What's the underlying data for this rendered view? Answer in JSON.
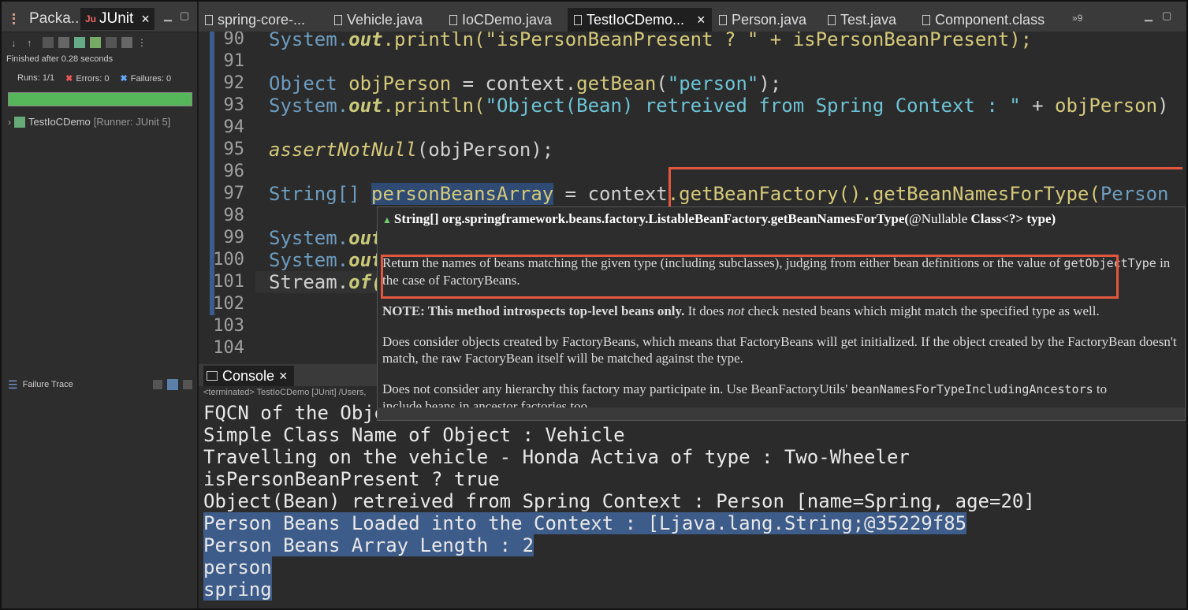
{
  "left_panel": {
    "tabs": [
      {
        "label": "Packa..."
      },
      {
        "label": "JUnit",
        "close": "×"
      }
    ],
    "status": "Finished after 0.28 seconds",
    "runs_label": "Runs:",
    "runs_value": "1/1",
    "errors_label": "Errors:",
    "errors_value": "0",
    "failures_label": "Failures:",
    "failures_value": "0",
    "progress_fraction": 1.0,
    "progress_color": "#56b75a",
    "test_name": "TestIoCDemo",
    "test_runner": "[Runner: JUnit 5]",
    "failure_trace_label": "Failure Trace"
  },
  "editor_tabs": [
    {
      "label": "spring-core-..."
    },
    {
      "label": "Vehicle.java"
    },
    {
      "label": "IoCDemo.java"
    },
    {
      "label": "TestIoCDemo...",
      "active": true,
      "close": "×"
    },
    {
      "label": "Person.java"
    },
    {
      "label": "Test.java"
    },
    {
      "label": "Component.class"
    },
    {
      "label": "»9"
    }
  ],
  "editor": {
    "line_numbers": [
      "90",
      "91",
      "92",
      "93",
      "94",
      "95",
      "96",
      "97",
      "98",
      "99",
      "100",
      "101",
      "102",
      "103",
      "104"
    ],
    "code": {
      "l90_a": "System.",
      "l90_b": "out",
      "l90_c": ".println(\"isPersonBeanPresent ? \" + isPersonBeanPresent);",
      "l92_a": "Object ",
      "l92_b": "objPerson",
      "l92_c": " = context.",
      "l92_d": "getBean",
      "l92_e": "(",
      "l92_f": "\"person\"",
      "l92_g": ");",
      "l93_a": "System.",
      "l93_b": "out",
      "l93_c": ".println(",
      "l93_d": "\"Object(Bean) retreived from Spring Context : \"",
      "l93_e": " + ",
      "l93_f": "objPerson",
      "l93_g": ")",
      "l95_a": "assertNotNull",
      "l95_b": "(objPerson);",
      "l97_a": "String[] ",
      "l97_b": "personBeansArray",
      "l97_c": " = context",
      "l97_d": ".getBeanFactory().getBeanNamesForType(",
      "l97_e": "Person",
      "l99_a": "System.",
      "l99_b": "out",
      "l100_a": "System.",
      "l100_b": "out",
      "l101_a": "Stream.",
      "l101_b": "of("
    }
  },
  "console": {
    "tab_label": "Console",
    "tab_close": "×",
    "terminated": "<terminated> TestIoCDemo [JUnit] /Users,",
    "lines": [
      "FQCN of the Obje",
      "Simple Class Name of Object : Vehicle",
      "Travelling on the vehicle - Honda Activa of type : Two-Wheeler",
      "isPersonBeanPresent ? true",
      "Object(Bean) retreived from Spring Context : Person [name=Spring, age=20]",
      "Person Beans Loaded into the Context : [Ljava.lang.String;@35229f85",
      "Person Beans Array Length : 2",
      "person",
      "spring"
    ]
  },
  "tooltip": {
    "sig_a": "String[] org.springframework.beans.factory.ListableBeanFactory.getBeanNamesForType(",
    "sig_b": "@Nullable",
    "sig_c": " Class<?> type)",
    "p1_a": "Return the names of beans matching the given type (including subclasses), judging from either bean definitions or the value of ",
    "p1_code": "getObjectType",
    "p1_b": " in the case of FactoryBeans.",
    "p2_bold": "NOTE: This method introspects top-level beans only.",
    "p2_a": " It does ",
    "p2_em": "not",
    "p2_b": " check nested beans which might match the specified type as well.",
    "p3": "Does consider objects created by FactoryBeans, which means that FactoryBeans will get initialized. If the object created by the FactoryBean doesn't match, the raw FactoryBean itself will be matched against the type.",
    "p4_a": "Does not consider any hierarchy this factory may participate in. Use BeanFactoryUtils' ",
    "p4_code": "beanNamesForTypeIncludingAncestors",
    "p4_b": " to",
    "p4_c": "include beans in ancestor factories too."
  },
  "colors": {
    "highlight_box": "#e4573f",
    "selection": "#3d5c8a"
  }
}
